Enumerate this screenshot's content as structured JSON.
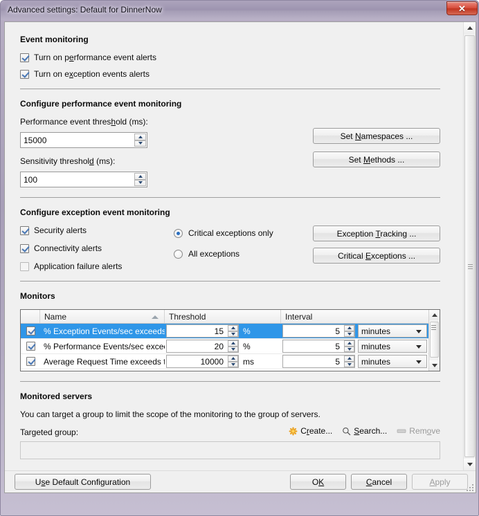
{
  "window": {
    "title": "Advanced settings: Default for DinnerNow",
    "close_label": "✕"
  },
  "event_monitoring": {
    "title": "Event monitoring",
    "checkboxes": [
      {
        "label_pre": "Turn on p",
        "accel": "e",
        "label_post": "rformance event alerts",
        "checked": true
      },
      {
        "label_pre": "Turn on e",
        "accel": "x",
        "label_post": "ception events alerts",
        "checked": true
      }
    ]
  },
  "performance_section": {
    "title": "Configure performance event monitoring",
    "threshold_label_pre": "Performance event thres",
    "threshold_accel": "h",
    "threshold_label_post": "old (ms):",
    "threshold_value": "15000",
    "sensitivity_label_pre": "Sensitivity threshol",
    "sensitivity_accel": "d",
    "sensitivity_label_post": " (ms):",
    "sensitivity_value": "100",
    "btn_namespaces_pre": "Set ",
    "btn_namespaces_accel": "N",
    "btn_namespaces_post": "amespaces ...",
    "btn_methods_pre": "Set ",
    "btn_methods_accel": "M",
    "btn_methods_post": "ethods ..."
  },
  "exception_section": {
    "title": "Configure exception event monitoring",
    "checkboxes": [
      {
        "label": "Security alerts",
        "checked": true
      },
      {
        "label": "Connectivity alerts",
        "checked": true
      },
      {
        "label": "Application failure alerts",
        "checked": false
      }
    ],
    "radios": [
      {
        "label": "Critical exceptions only",
        "selected": true
      },
      {
        "label": "All exceptions",
        "selected": false
      }
    ],
    "btn_tracking_pre": "Exception ",
    "btn_tracking_accel": "T",
    "btn_tracking_post": "racking ...",
    "btn_critical_pre": "Critical ",
    "btn_critical_accel": "E",
    "btn_critical_post": "xceptions ..."
  },
  "monitors": {
    "title": "Monitors",
    "columns": {
      "select": "",
      "name": "Name",
      "threshold": "Threshold",
      "interval": "Interval"
    },
    "sort_column": "Name",
    "sort_direction": "ascending",
    "rows": [
      {
        "checked": true,
        "selected": true,
        "name": "% Exception Events/sec exceeds ...",
        "threshold": "15",
        "unit": "%",
        "interval": "5",
        "interval_unit": "minutes"
      },
      {
        "checked": true,
        "selected": false,
        "name": "% Performance Events/sec excee...",
        "threshold": "20",
        "unit": "%",
        "interval": "5",
        "interval_unit": "minutes"
      },
      {
        "checked": true,
        "selected": false,
        "name": "Average Request Time exceeds th...",
        "threshold": "10000",
        "unit": "ms",
        "interval": "5",
        "interval_unit": "minutes"
      }
    ]
  },
  "monitored_servers": {
    "title": "Monitored servers",
    "description": "You can target a group to limit the scope of the monitoring to the group of servers.",
    "targeted_group_label": "Targeted group:",
    "targeted_group_value": "",
    "commands": [
      {
        "pre": "C",
        "accel": "r",
        "post": "eate...",
        "icon": "star-icon",
        "disabled": false
      },
      {
        "pre": "",
        "accel": "S",
        "post": "earch...",
        "icon": "magnifier-icon",
        "disabled": false
      },
      {
        "pre": "Rem",
        "accel": "o",
        "post": "ve",
        "icon": "remove-bar-icon",
        "disabled": true
      }
    ]
  },
  "footer": {
    "default_config_pre": "U",
    "default_config_accel": "s",
    "default_config_post": "e Default Configuration",
    "ok_pre": "O",
    "ok_accel": "K",
    "ok_post": "",
    "cancel_pre": "",
    "cancel_accel": "C",
    "cancel_post": "ancel",
    "apply_pre": "",
    "apply_accel": "A",
    "apply_post": "pply",
    "apply_disabled": true
  },
  "colors": {
    "selection_blue": "#2f96e8",
    "close_red": "#d9503f",
    "frame_mauve": "#a89fb8"
  }
}
